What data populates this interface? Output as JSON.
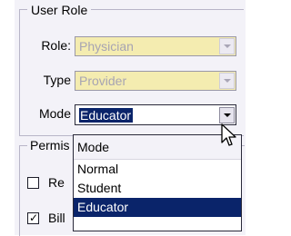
{
  "user_role": {
    "title": "User Role",
    "fields": [
      {
        "label": "Role:",
        "value": "Physician"
      },
      {
        "label": "Type",
        "value": "Provider"
      },
      {
        "label": "Mode",
        "value": "Educator"
      }
    ]
  },
  "permissions": {
    "title": "Permis",
    "items": [
      {
        "label": "Re",
        "checked": false
      },
      {
        "label": "Bill",
        "checked": true
      }
    ]
  },
  "mode_dropdown": {
    "header": "Mode",
    "options": [
      "Normal",
      "Student",
      "Educator"
    ],
    "selected": "Educator"
  },
  "colors": {
    "readonly_field": "#f4ecb0",
    "selection": "#0a246a",
    "panel": "#f3f2f8"
  }
}
